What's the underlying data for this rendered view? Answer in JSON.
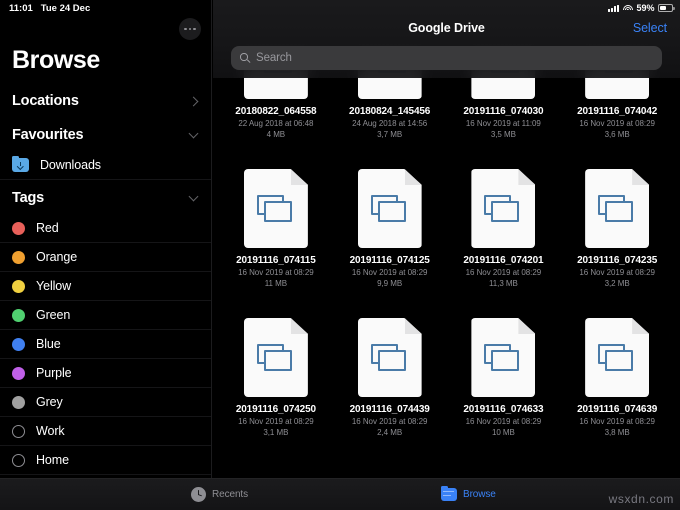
{
  "statusbar": {
    "time": "11:01",
    "date": "Tue 24 Dec",
    "battery_percent": "59%",
    "signal_icon": "cellular-signal-icon",
    "wifi_icon": "wifi-icon",
    "battery_icon": "battery-icon"
  },
  "sidebar": {
    "title": "Browse",
    "more_button": "more-options-button",
    "sections": [
      {
        "label": "Locations",
        "chevron": "chevron-right-icon",
        "items": []
      },
      {
        "label": "Favourites",
        "chevron": "chevron-down-icon",
        "items": [
          {
            "label": "Downloads",
            "icon": "downloads-folder-icon",
            "color": "#5aa9e6"
          }
        ]
      },
      {
        "label": "Tags",
        "chevron": "chevron-down-icon",
        "items": [
          {
            "label": "Red",
            "icon": "tag-dot-icon",
            "color": "#e8605a",
            "hollow": false
          },
          {
            "label": "Orange",
            "icon": "tag-dot-icon",
            "color": "#f0a030",
            "hollow": false
          },
          {
            "label": "Yellow",
            "icon": "tag-dot-icon",
            "color": "#f0d040",
            "hollow": false
          },
          {
            "label": "Green",
            "icon": "tag-dot-icon",
            "color": "#50d070",
            "hollow": false
          },
          {
            "label": "Blue",
            "icon": "tag-dot-icon",
            "color": "#4080f0",
            "hollow": false
          },
          {
            "label": "Purple",
            "icon": "tag-dot-icon",
            "color": "#c060e8",
            "hollow": false
          },
          {
            "label": "Grey",
            "icon": "tag-dot-icon",
            "color": "#a0a0a0",
            "hollow": false
          },
          {
            "label": "Work",
            "icon": "tag-dot-outline-icon",
            "color": "transparent",
            "hollow": true
          },
          {
            "label": "Home",
            "icon": "tag-dot-outline-icon",
            "color": "transparent",
            "hollow": true
          }
        ]
      }
    ]
  },
  "main": {
    "title": "Google Drive",
    "select_label": "Select",
    "search": {
      "placeholder": "Search",
      "value": "",
      "icon": "search-icon"
    },
    "files": [
      {
        "name": "20180822_064558",
        "date": "22 Aug 2018 at 06:48",
        "size": "4 MB",
        "icon": "image-document-icon"
      },
      {
        "name": "20180824_145456",
        "date": "24 Aug 2018 at 14:56",
        "size": "3,7 MB",
        "icon": "image-document-icon"
      },
      {
        "name": "20191116_074030",
        "date": "16 Nov 2019 at 11:09",
        "size": "3,5 MB",
        "icon": "image-document-icon"
      },
      {
        "name": "20191116_074042",
        "date": "16 Nov 2019 at 08:29",
        "size": "3,6 MB",
        "icon": "image-document-icon"
      },
      {
        "name": "20191116_074115",
        "date": "16 Nov 2019 at 08:29",
        "size": "11 MB",
        "icon": "image-document-icon"
      },
      {
        "name": "20191116_074125",
        "date": "16 Nov 2019 at 08:29",
        "size": "9,9 MB",
        "icon": "image-document-icon"
      },
      {
        "name": "20191116_074201",
        "date": "16 Nov 2019 at 08:29",
        "size": "11,3 MB",
        "icon": "image-document-icon"
      },
      {
        "name": "20191116_074235",
        "date": "16 Nov 2019 at 08:29",
        "size": "3,2 MB",
        "icon": "image-document-icon"
      },
      {
        "name": "20191116_074250",
        "date": "16 Nov 2019 at 08:29",
        "size": "3,1 MB",
        "icon": "image-document-icon"
      },
      {
        "name": "20191116_074439",
        "date": "16 Nov 2019 at 08:29",
        "size": "2,4 MB",
        "icon": "image-document-icon"
      },
      {
        "name": "20191116_074633",
        "date": "16 Nov 2019 at 08:29",
        "size": "10 MB",
        "icon": "image-document-icon"
      },
      {
        "name": "20191116_074639",
        "date": "16 Nov 2019 at 08:29",
        "size": "3,8 MB",
        "icon": "image-document-icon"
      }
    ]
  },
  "tabbar": {
    "tabs": [
      {
        "label": "Recents",
        "icon": "clock-icon",
        "active": false
      },
      {
        "label": "Browse",
        "icon": "folder-icon",
        "active": true
      }
    ]
  },
  "watermark": "wsxdn.com",
  "colors": {
    "accent": "#3a82f6",
    "background": "#000000",
    "secondary_text": "#8e8e93"
  }
}
